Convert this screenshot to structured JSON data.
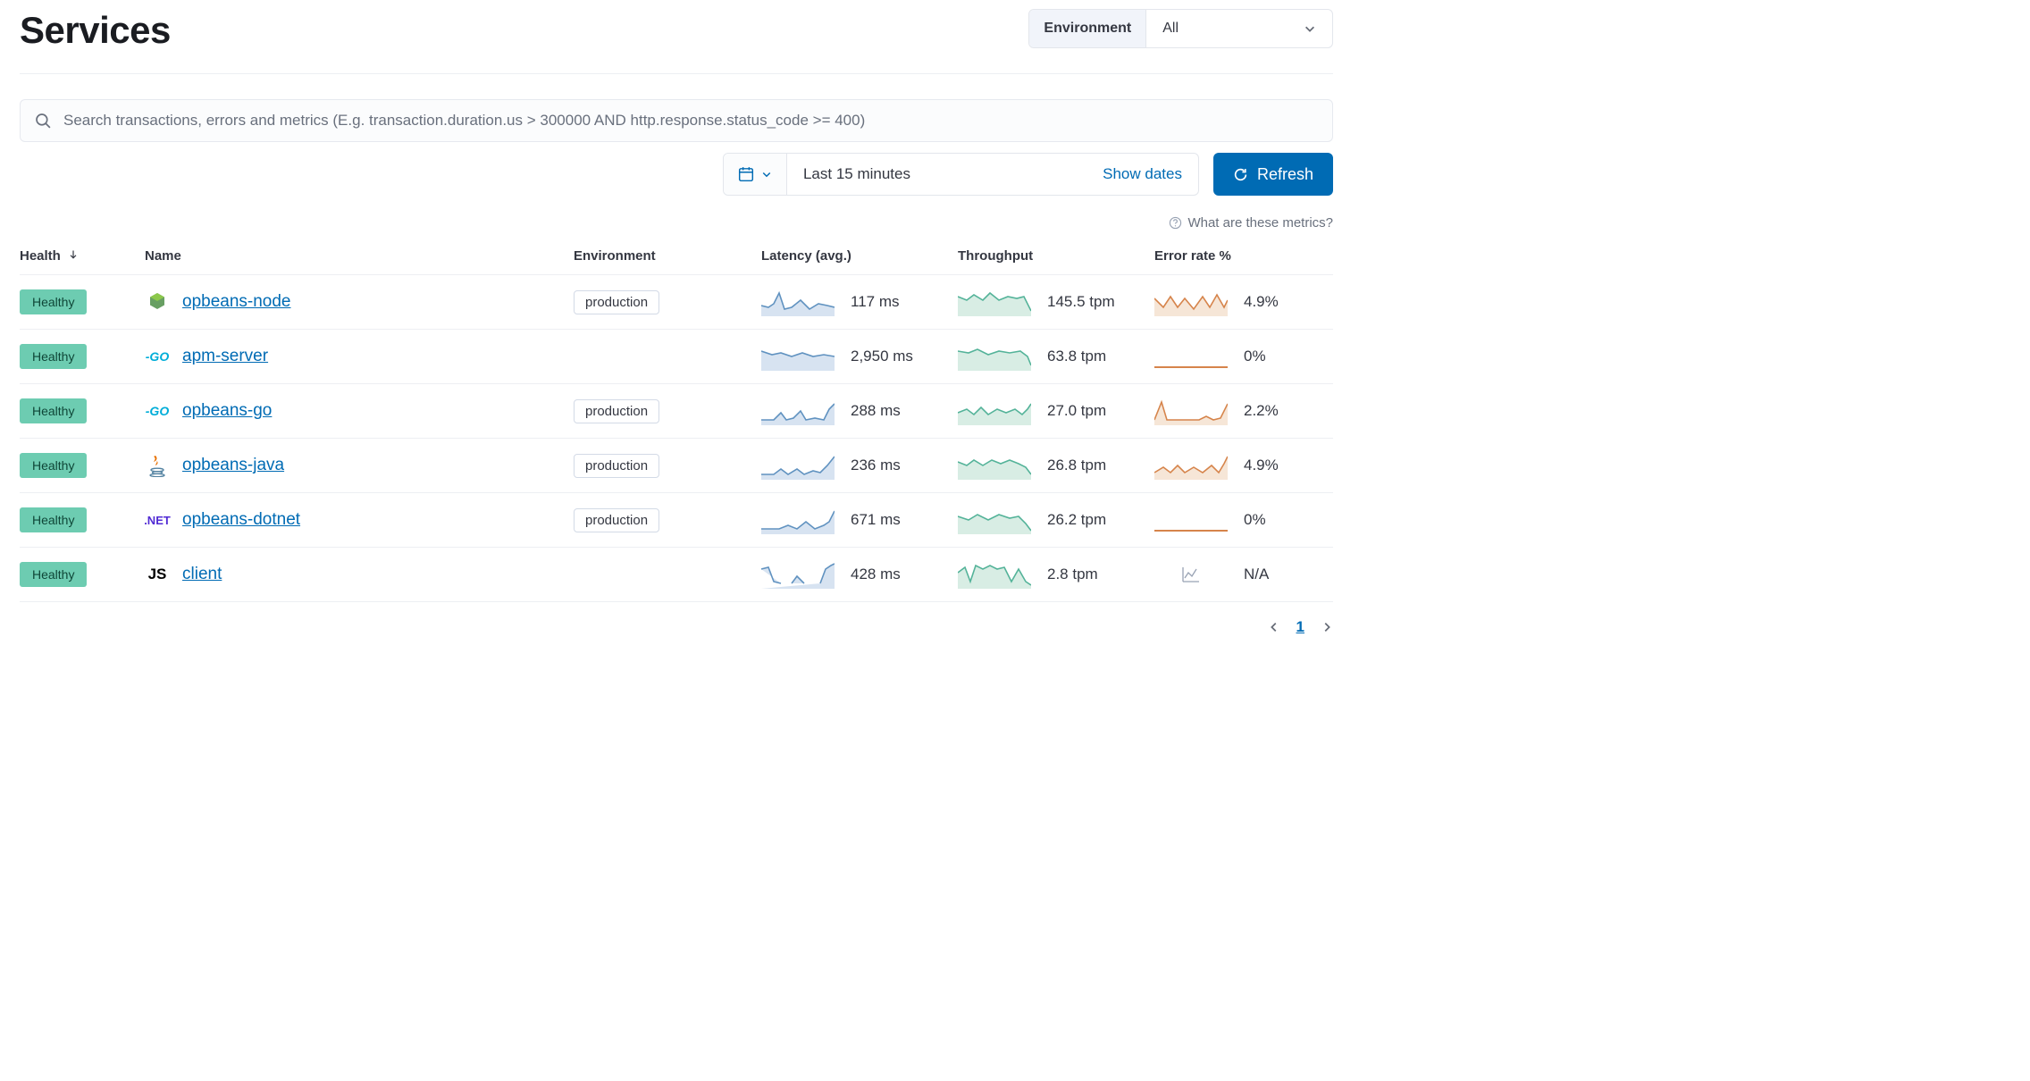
{
  "page_title": "Services",
  "environment": {
    "label": "Environment",
    "selected": "All"
  },
  "search": {
    "placeholder": "Search transactions, errors and metrics (E.g. transaction.duration.us > 300000 AND http.response.status_code >= 400)"
  },
  "time": {
    "range": "Last 15 minutes",
    "show_dates": "Show dates",
    "refresh": "Refresh"
  },
  "help_text": "What are these metrics?",
  "columns": {
    "health": "Health",
    "name": "Name",
    "env": "Environment",
    "latency": "Latency (avg.)",
    "throughput": "Throughput",
    "error": "Error rate %"
  },
  "rows": [
    {
      "health": "Healthy",
      "icon": "node",
      "name": "opbeans-node",
      "env": "production",
      "latency": "117 ms",
      "throughput": "145.5 tpm",
      "error": "4.9%",
      "has_err_spark": true
    },
    {
      "health": "Healthy",
      "icon": "go",
      "name": "apm-server",
      "env": "",
      "latency": "2,950 ms",
      "throughput": "63.8 tpm",
      "error": "0%",
      "has_err_spark": false
    },
    {
      "health": "Healthy",
      "icon": "go",
      "name": "opbeans-go",
      "env": "production",
      "latency": "288 ms",
      "throughput": "27.0 tpm",
      "error": "2.2%",
      "has_err_spark": true
    },
    {
      "health": "Healthy",
      "icon": "java",
      "name": "opbeans-java",
      "env": "production",
      "latency": "236 ms",
      "throughput": "26.8 tpm",
      "error": "4.9%",
      "has_err_spark": true
    },
    {
      "health": "Healthy",
      "icon": "net",
      "name": "opbeans-dotnet",
      "env": "production",
      "latency": "671 ms",
      "throughput": "26.2 tpm",
      "error": "0%",
      "has_err_spark": false
    },
    {
      "health": "Healthy",
      "icon": "js",
      "name": "client",
      "env": "",
      "latency": "428 ms",
      "throughput": "2.8 tpm",
      "error": "N/A",
      "has_err_spark": null
    }
  ],
  "pagination": {
    "current": "1"
  },
  "colors": {
    "link": "#006bb4",
    "badge": "#6dccb1",
    "latency": "#6092c0",
    "throughput": "#54b399",
    "error": "#d6844b"
  }
}
